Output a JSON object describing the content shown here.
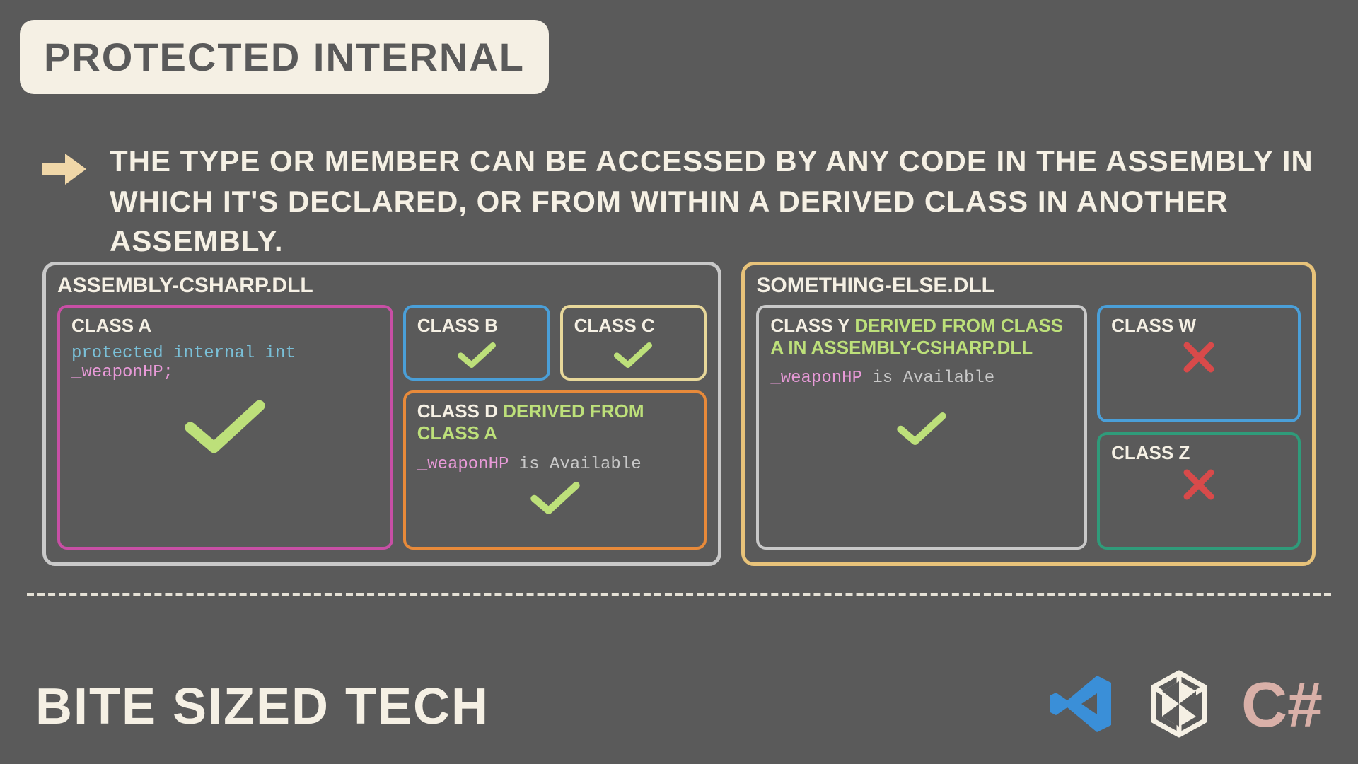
{
  "title": "PROTECTED INTERNAL",
  "description": "The type or member can be accessed by any code in the assembly in which it's declared, or from within a derived class in another assembly.",
  "assemblies": {
    "a": {
      "name": "Assembly-CSharp.dll",
      "classes": {
        "A": {
          "title": "Class A",
          "code_kw": "protected internal int",
          "code_ident": "_weaponHP;",
          "status": "check"
        },
        "B": {
          "title": "Class B",
          "status": "check"
        },
        "C": {
          "title": "Class C",
          "status": "check"
        },
        "D": {
          "title": "Class D",
          "derived": "Derived From Class A",
          "avail_ident": "_weaponHP",
          "avail_rest": " is Available",
          "status": "check"
        }
      }
    },
    "b": {
      "name": "Something-else.dll",
      "classes": {
        "Y": {
          "title": "Class Y",
          "derived": "Derived From Class A in Assembly-CSharp.dll",
          "avail_ident": "_weaponHP",
          "avail_rest": " is Available",
          "status": "check"
        },
        "W": {
          "title": "Class W",
          "status": "cross"
        },
        "Z": {
          "title": "Class Z",
          "status": "cross"
        }
      }
    }
  },
  "brand": "BITE SIZED TECH",
  "logos": {
    "csharp": "C#"
  },
  "icons": {
    "check": "check-icon",
    "cross": "cross-icon",
    "arrow": "arrow-right-icon",
    "vscode": "vscode-icon",
    "unity": "unity-icon"
  },
  "colors": {
    "bg": "#5a5a5a",
    "cream": "#f5f0e4",
    "green": "#bde07a",
    "magenta": "#c84fa5",
    "blue": "#4a9fd8",
    "tan": "#e8d89a",
    "orange": "#e88a3a",
    "teal": "#2f9b7a",
    "gold": "#e8c37a",
    "red": "#d84a4a",
    "pink": "#d9b0a8"
  }
}
